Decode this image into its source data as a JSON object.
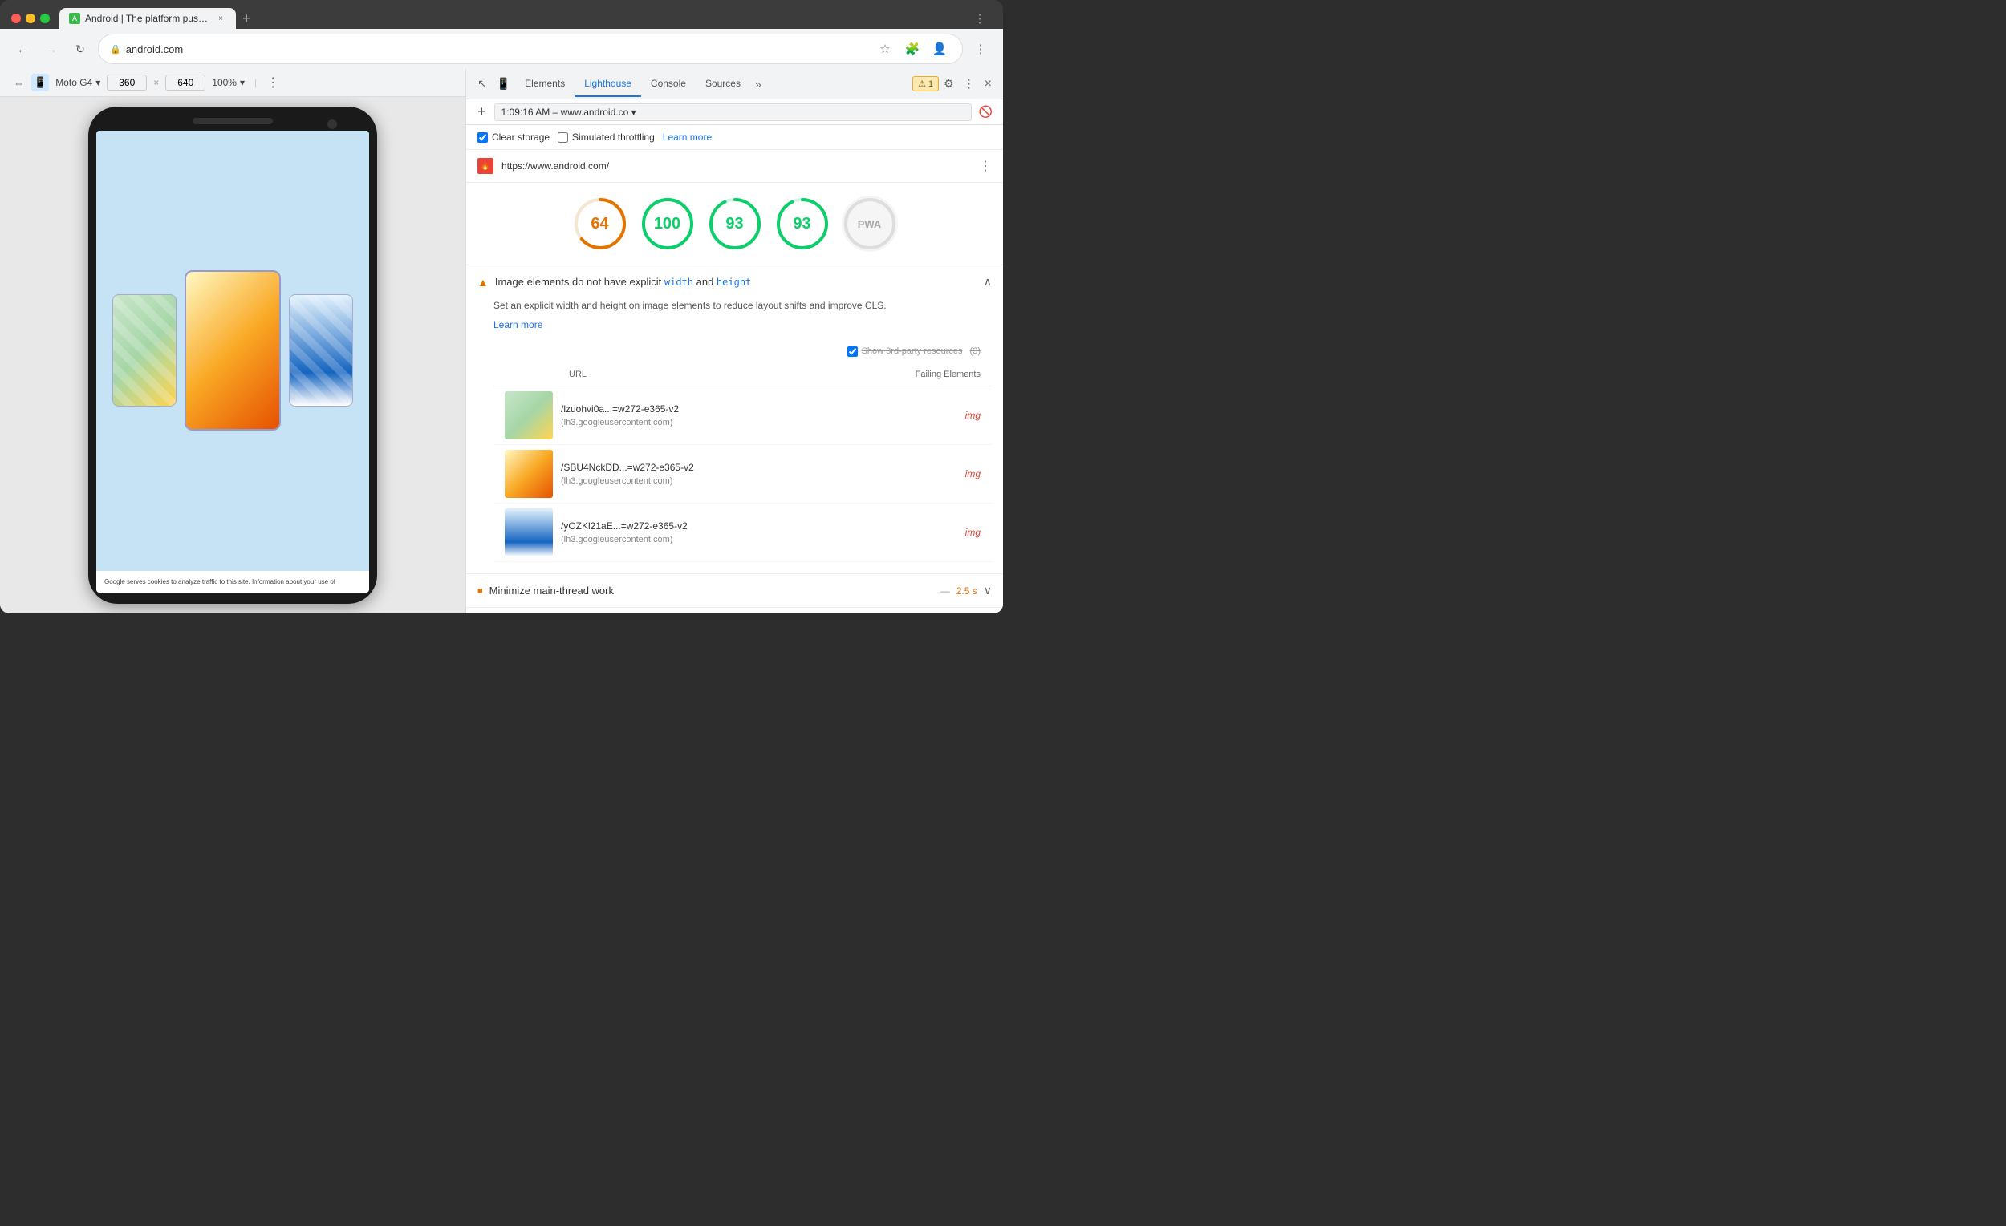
{
  "browser": {
    "tab_title": "Android | The platform pushing",
    "tab_close": "×",
    "new_tab": "+",
    "nav_back": "←",
    "nav_forward": "→",
    "nav_refresh": "↻",
    "address": "android.com",
    "address_lock": "🔒",
    "extensions_icon": "puzzle",
    "profile_icon": "person",
    "more_icon": "⋮",
    "star_icon": "☆",
    "cast_icon": "cast"
  },
  "device_toolbar": {
    "device": "Moto G4",
    "width": "360",
    "height_label": "×",
    "height": "640",
    "zoom": "100%",
    "separator": "|",
    "more_icon": "⋮",
    "responsive_icon": "⇔",
    "device_icon": "📱"
  },
  "devtools": {
    "tabs": [
      {
        "label": "Elements",
        "active": false
      },
      {
        "label": "Lighthouse",
        "active": true
      },
      {
        "label": "Console",
        "active": false
      },
      {
        "label": "Sources",
        "active": false
      }
    ],
    "more_tabs": "»",
    "warning_count": "1",
    "warning_icon": "⚠",
    "settings_icon": "⚙",
    "more_icon": "⋮",
    "close_icon": "×",
    "add_btn": "+",
    "url_display": "1:09:16 AM – www.android.co ▾",
    "delete_icon": "🚫",
    "clear_storage_label": "Clear storage",
    "simulated_throttling_label": "Simulated throttling",
    "learn_more": "Learn more",
    "report_url": "https://www.android.com/",
    "report_more": "⋮"
  },
  "scores": [
    {
      "value": "64",
      "color_type": "orange",
      "stroke_color": "#e37400",
      "stroke_bg": "#f5e6d0",
      "pct": 64
    },
    {
      "value": "100",
      "color_type": "green",
      "stroke_color": "#0cce6b",
      "stroke_bg": "#d0f5e6",
      "pct": 100
    },
    {
      "value": "93",
      "color_type": "green",
      "stroke_color": "#0cce6b",
      "stroke_bg": "#d0f5e6",
      "pct": 93
    },
    {
      "value": "93",
      "color_type": "green",
      "stroke_color": "#0cce6b",
      "stroke_bg": "#d0f5e6",
      "pct": 93
    },
    {
      "value": "PWA",
      "color_type": "pwa",
      "stroke_color": "#ccc",
      "stroke_bg": "#eee",
      "pct": 0
    }
  ],
  "audit": {
    "icon": "▲",
    "title_prefix": "Image elements do not have explicit ",
    "title_code1": "width",
    "title_and": " and ",
    "title_code2": "height",
    "expand_icon": "∧",
    "body_text": "Set an explicit width and height on image elements to reduce layout shifts and improve CLS.",
    "learn_more": "Learn more",
    "third_party_label": "Show 3rd-party resources",
    "third_party_count": "(3)",
    "table_header_url": "URL",
    "table_header_failing": "Failing Elements",
    "rows": [
      {
        "url_path": "/lzuohvi0a...=w272-e365-v2",
        "url_host": "(lh3.googleusercontent.com)",
        "failing": "img",
        "thumb_class": "thumb-1"
      },
      {
        "url_path": "/SBU4NckDD...=w272-e365-v2",
        "url_host": "(lh3.googleusercontent.com)",
        "failing": "img",
        "thumb_class": "thumb-2"
      },
      {
        "url_path": "/yOZKl21aE...=w272-e365-v2",
        "url_host": "(lh3.googleusercontent.com)",
        "failing": "img",
        "thumb_class": "thumb-3"
      }
    ]
  },
  "bottom_audit": {
    "icon": "■",
    "title": "Minimize main-thread work",
    "dash": "—",
    "value": "2.5 s",
    "expand_icon": "∨"
  },
  "phone_bottom_text": "Google serves cookies to analyze traffic to this site. Information about your use of"
}
